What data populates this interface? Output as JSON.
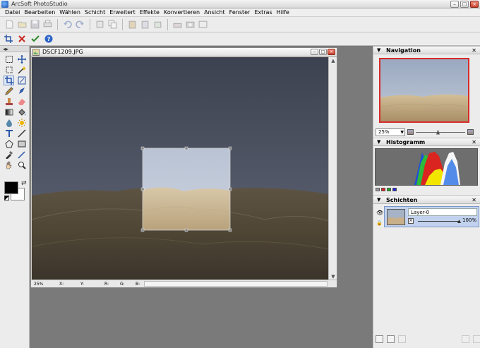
{
  "app": {
    "title": "ArcSoft PhotoStudio",
    "menus": [
      "Datei",
      "Bearbeiten",
      "Wählen",
      "Schicht",
      "Erweitert",
      "Effekte",
      "Konvertieren",
      "Ansicht",
      "Fenster",
      "Extras",
      "Hilfe"
    ]
  },
  "document": {
    "name": "DSCF1209.JPG",
    "status": {
      "zoom": "25%",
      "x": "X:",
      "y": "Y:",
      "r": "R:",
      "g": "G:",
      "b": "B:"
    }
  },
  "panels": {
    "navigation": {
      "title": "Navigation",
      "zoom": "25%",
      "zoom_slider_level": 0.45
    },
    "histogram": {
      "title": "Histogramm"
    },
    "layers": {
      "title": "Schichten",
      "layers": [
        {
          "name": "Layer-0",
          "opacity": "100%"
        }
      ]
    }
  },
  "colors": {
    "foreground": "#000000",
    "background": "#ffffff",
    "nav_frame": "#d62b2b",
    "layer_selected": "#c2d2ee"
  }
}
